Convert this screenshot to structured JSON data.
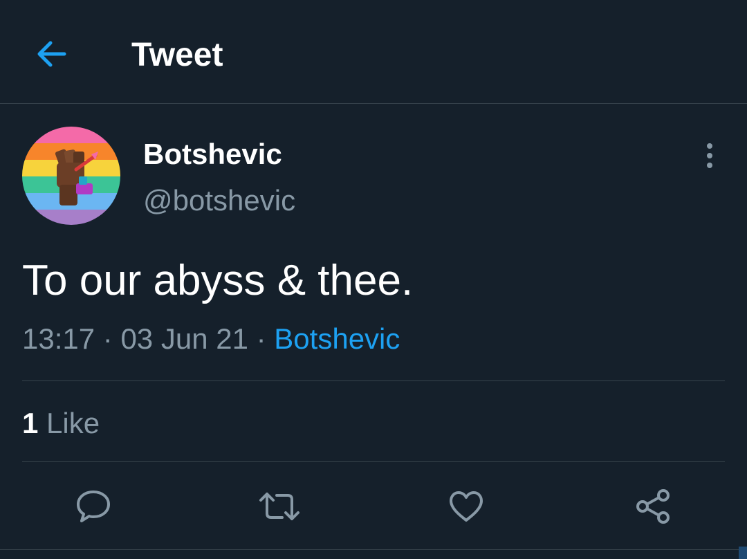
{
  "header": {
    "title": "Tweet",
    "back_icon": "arrow-left-icon",
    "accent_color": "#1da1f2"
  },
  "tweet": {
    "author": {
      "display_name": "Botshevic",
      "handle": "@botshevic",
      "avatar_icon": "raised-fist-pride-avatar"
    },
    "text": "To our abyss & thee.",
    "time": "13:17",
    "date": "03 Jun 21",
    "separator": "·",
    "source": "Botshevic",
    "likes": {
      "count": "1",
      "label": "Like"
    }
  },
  "actions": [
    {
      "name": "reply",
      "icon": "comment-icon"
    },
    {
      "name": "retweet",
      "icon": "retweet-icon"
    },
    {
      "name": "like",
      "icon": "heart-icon"
    },
    {
      "name": "share",
      "icon": "share-icon"
    }
  ],
  "colors": {
    "background": "#15202b",
    "secondary_text": "#8899a6",
    "divider": "#38444d",
    "link": "#1da1f2"
  }
}
